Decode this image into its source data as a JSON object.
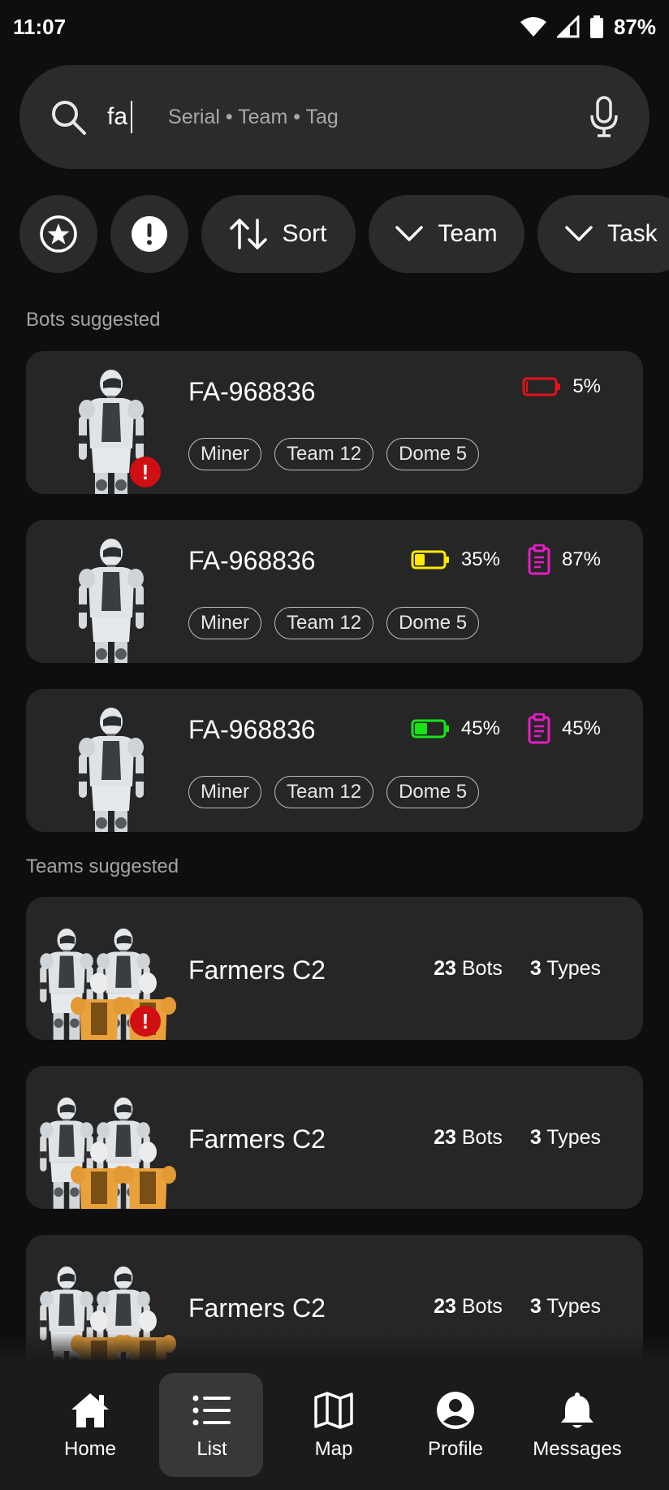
{
  "status_bar": {
    "time": "11:07",
    "battery_percent": "87%"
  },
  "search": {
    "value": "fa",
    "hint": "Serial • Team • Tag"
  },
  "filters": [
    {
      "icon": "star-icon"
    },
    {
      "icon": "alert-icon"
    },
    {
      "label": "Sort"
    },
    {
      "label": "Team"
    },
    {
      "label": "Task"
    }
  ],
  "bots_section": {
    "label": "Bots suggested"
  },
  "bots": [
    {
      "name": "FA-968836",
      "alert": "!",
      "battery": {
        "value": 5,
        "label": "5%",
        "color": "#e8101c"
      },
      "task": null,
      "tags": [
        "Miner",
        "Team 12",
        "Dome 5"
      ]
    },
    {
      "name": "FA-968836",
      "alert": null,
      "battery": {
        "value": 35,
        "label": "35%",
        "color": "#ffea00"
      },
      "task": {
        "label": "87%",
        "color": "#e81cc7"
      },
      "tags": [
        "Miner",
        "Team 12",
        "Dome 5"
      ]
    },
    {
      "name": "FA-968836",
      "alert": null,
      "battery": {
        "value": 45,
        "label": "45%",
        "color": "#18e316"
      },
      "task": {
        "label": "45%",
        "color": "#e81cc7"
      },
      "tags": [
        "Miner",
        "Team 12",
        "Dome 5"
      ]
    }
  ],
  "teams_section": {
    "label": "Teams suggested"
  },
  "teams": [
    {
      "name": "Farmers C2",
      "alert": "!",
      "bots_count": "23",
      "bots_label": "Bots",
      "types_count": "3",
      "types_label": "Types"
    },
    {
      "name": "Farmers C2",
      "alert": null,
      "bots_count": "23",
      "bots_label": "Bots",
      "types_count": "3",
      "types_label": "Types"
    },
    {
      "name": "Farmers C2",
      "alert": null,
      "bots_count": "23",
      "bots_label": "Bots",
      "types_count": "3",
      "types_label": "Types"
    }
  ],
  "nav": [
    {
      "label": "Home",
      "icon": "home-icon",
      "active": false
    },
    {
      "label": "List",
      "icon": "list-icon",
      "active": true
    },
    {
      "label": "Map",
      "icon": "map-icon",
      "active": false
    },
    {
      "label": "Profile",
      "icon": "profile-icon",
      "active": false
    },
    {
      "label": "Messages",
      "icon": "bell-icon",
      "active": false
    }
  ],
  "colors": {
    "background": "#0e0e0e",
    "surface": "#262626",
    "alert": "#cf0f12"
  }
}
